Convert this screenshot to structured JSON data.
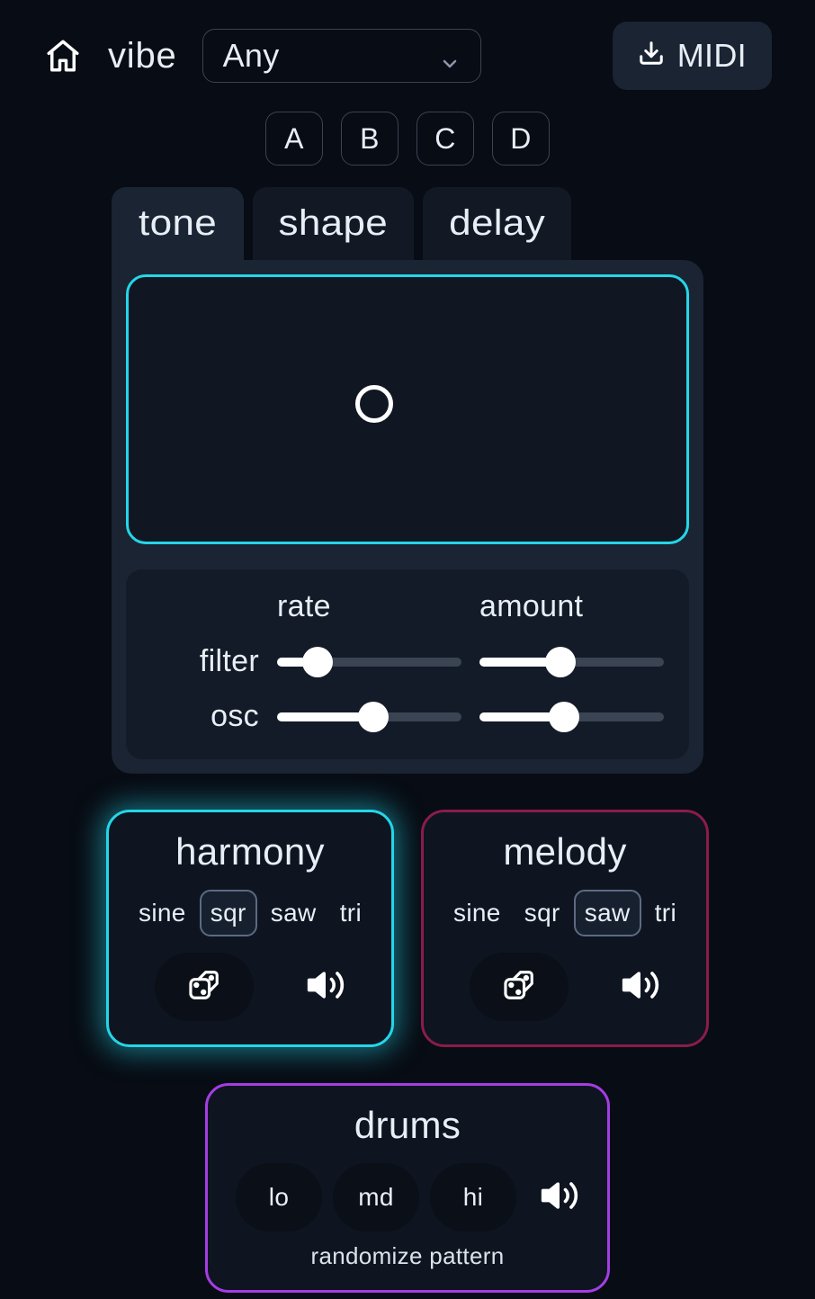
{
  "header": {
    "vibe_label": "vibe",
    "vibe_selected": "Any",
    "midi_label": "MIDI"
  },
  "presets": [
    "A",
    "B",
    "C",
    "D"
  ],
  "tabs": {
    "items": [
      "tone",
      "shape",
      "delay"
    ],
    "active": "tone"
  },
  "mod": {
    "rate_label": "rate",
    "amount_label": "amount",
    "rows": [
      {
        "label": "filter",
        "rate": 22,
        "amount": 44
      },
      {
        "label": "osc",
        "rate": 52,
        "amount": 46
      }
    ]
  },
  "voices": {
    "harmony": {
      "title": "harmony",
      "waves": [
        "sine",
        "sqr",
        "saw",
        "tri"
      ],
      "selected": "sqr"
    },
    "melody": {
      "title": "melody",
      "waves": [
        "sine",
        "sqr",
        "saw",
        "tri"
      ],
      "selected": "saw"
    }
  },
  "drums": {
    "title": "drums",
    "buttons": [
      "lo",
      "md",
      "hi"
    ],
    "randomize_label": "randomize pattern"
  }
}
